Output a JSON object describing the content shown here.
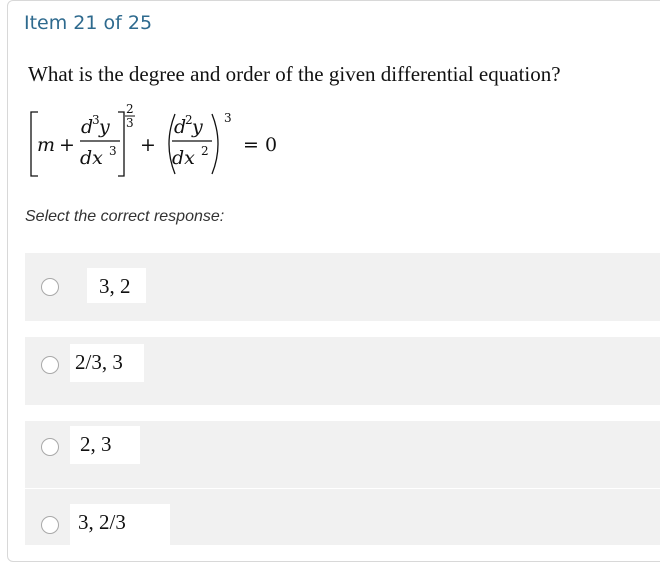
{
  "header": {
    "item_counter": "Item 21 of 25"
  },
  "question": {
    "text": "What is the degree and order of the given differential equation?",
    "equation": "[m + d³y/dx³]^(2/3) + (d²y/dx²)^3 = 0"
  },
  "prompt": "Select the correct response:",
  "options": [
    {
      "label": "3, 2",
      "selected": false
    },
    {
      "label": "2/3, 3",
      "selected": false
    },
    {
      "label": "2, 3",
      "selected": false
    },
    {
      "label": "3, 2/3",
      "selected": false
    }
  ]
}
